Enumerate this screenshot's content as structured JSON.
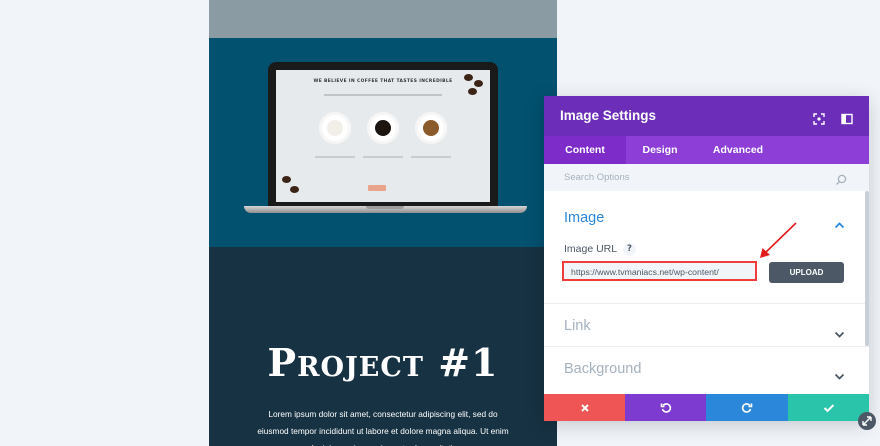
{
  "preview": {
    "screen_headline": "WE BELIEVE IN COFFEE THAT TASTES INCREDIBLE",
    "project_title": "Project #1",
    "project_body": "Lorem ipsum dolor sit amet, consectetur adipiscing elit, sed do eiusmod tempor incididunt ut labore et dolore magna aliqua. Ut enim ad minim veniam, quis nostrud exercitation"
  },
  "modal": {
    "title": "Image Settings",
    "tabs": [
      {
        "label": "Content",
        "active": true
      },
      {
        "label": "Design",
        "active": false
      },
      {
        "label": "Advanced",
        "active": false
      }
    ],
    "search_placeholder": "Search Options",
    "sections": {
      "image": "Image",
      "link": "Link",
      "background": "Background"
    },
    "image_url_label": "Image URL",
    "help_glyph": "?",
    "image_url_value": "https://www.tvmaniacs.net/wp-content/",
    "upload_label": "UPLOAD"
  },
  "colors": {
    "accent": "#2b87da",
    "header_purple": "#6c2eb9",
    "tab_purple": "#8c3ed6",
    "cancel": "#ef5555",
    "undo": "#7e3bd0",
    "redo": "#2b87da",
    "save": "#29c4a9",
    "highlight": "#ef3c3c"
  },
  "icons": {
    "header_left": "focus-frame-icon",
    "header_right": "split-view-icon",
    "search": "search-icon",
    "footer": [
      "close-icon",
      "undo-icon",
      "redo-icon",
      "check-icon"
    ]
  }
}
